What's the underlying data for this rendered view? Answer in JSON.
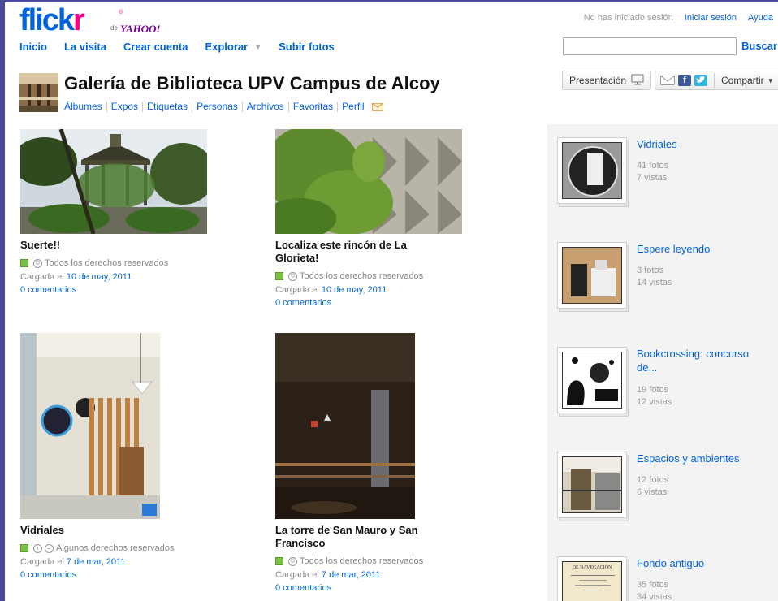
{
  "brand": {
    "name_part1": "flick",
    "name_part2": "r",
    "de": "de",
    "yahoo": "YAHOO!",
    "reg": "®"
  },
  "topnav": [
    {
      "label": "Inicio"
    },
    {
      "label": "La visita"
    },
    {
      "label": "Crear cuenta"
    },
    {
      "label": "Explorar",
      "has_dropdown": true
    },
    {
      "label": "Subir fotos"
    }
  ],
  "utility": {
    "status": "No has iniciado sesión",
    "login": "Iniciar sesión",
    "help": "Ayuda"
  },
  "search": {
    "value": "",
    "button": "Buscar"
  },
  "gallery": {
    "title": "Galería de Biblioteca UPV Campus de Alcoy",
    "subnav": [
      "Álbumes",
      "Expos",
      "Etiquetas",
      "Personas",
      "Archivos",
      "Favoritas",
      "Perfil"
    ]
  },
  "actions": {
    "presentation": "Presentación",
    "share": "Compartir"
  },
  "photos": [
    {
      "title": "Suerte!!",
      "rights": "Todos los derechos reservados",
      "uploaded_prefix": "Cargada el",
      "date": "10 de may, 2011",
      "comments": "0 comentarios",
      "license": "all-rights-reserved"
    },
    {
      "title": "Localiza este rincón de La Glorieta!",
      "rights": "Todos los derechos reservados",
      "uploaded_prefix": "Cargada el",
      "date": "10 de may, 2011",
      "comments": "0 comentarios",
      "license": "all-rights-reserved"
    },
    {
      "title": "Vidriales",
      "rights": "Algunos derechos reservados",
      "uploaded_prefix": "Cargada el",
      "date": "7 de mar, 2011",
      "comments": "0 comentarios",
      "license": "some-rights-reserved"
    },
    {
      "title": "La torre de San Mauro y San Francisco",
      "rights": "Todos los derechos reservados",
      "uploaded_prefix": "Cargada el",
      "date": "7 de mar, 2011",
      "comments": "0 comentarios",
      "license": "all-rights-reserved"
    }
  ],
  "sets": [
    {
      "title": "Vidriales",
      "photos": "41 fotos",
      "views": "7 vistas"
    },
    {
      "title": "Espere leyendo",
      "photos": "3 fotos",
      "views": "14 vistas"
    },
    {
      "title": "Bookcrossing: concurso de...",
      "photos": "19 fotos",
      "views": "12 vistas"
    },
    {
      "title": "Espacios y ambientes",
      "photos": "12 fotos",
      "views": "6 vistas"
    },
    {
      "title": "Fondo antiguo",
      "photos": "35 fotos",
      "views": "34 vistas",
      "thumb_caption": "DE NAVEGACIÓN"
    }
  ],
  "colors": {
    "link": "#0063dc",
    "brand_pink": "#ff0084",
    "yahoo_purple": "#7b0099",
    "sidebar_bg": "#f3f3f3"
  }
}
